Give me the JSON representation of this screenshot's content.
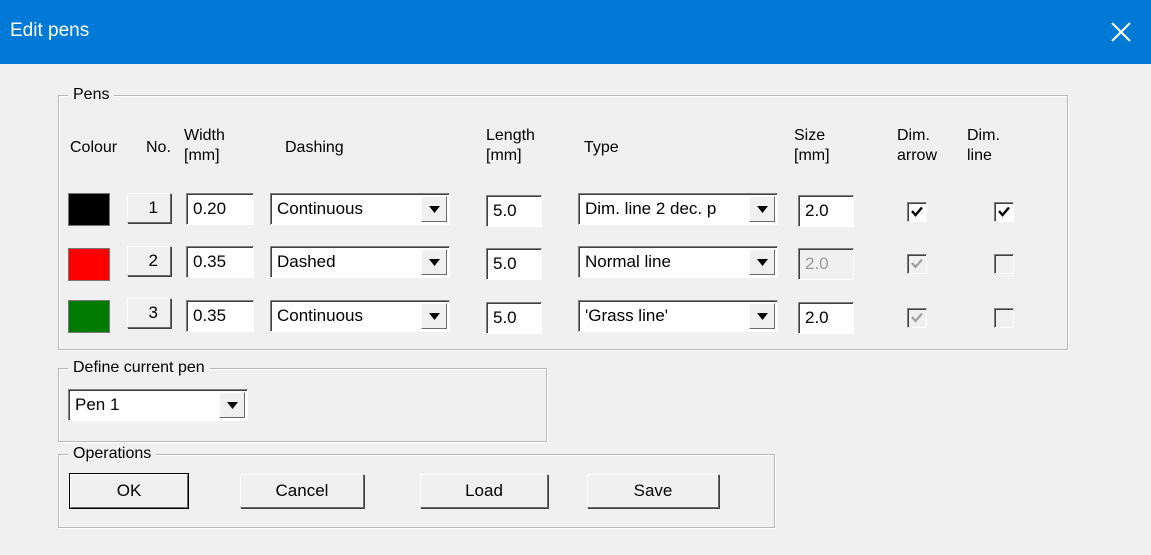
{
  "window": {
    "title": "Edit pens"
  },
  "pens_group": {
    "label": "Pens",
    "headers": {
      "colour": "Colour",
      "no": "No.",
      "width": "Width\n[mm]",
      "dashing": "Dashing",
      "length": "Length\n[mm]",
      "type": "Type",
      "size": "Size\n[mm]",
      "dim_arrow": "Dim.\narrow",
      "dim_line": "Dim.\nline"
    },
    "rows": [
      {
        "colour": "#000000",
        "no": "1",
        "width": "0.20",
        "dashing": "Continuous",
        "length": "5.0",
        "type": "Dim. line 2 dec. p",
        "size": "2.0",
        "size_enabled": true,
        "dim_arrow_checked": true,
        "dim_arrow_enabled": true,
        "dim_line_checked": true,
        "dim_line_enabled": true
      },
      {
        "colour": "#ff0000",
        "no": "2",
        "width": "0.35",
        "dashing": "Dashed",
        "length": "5.0",
        "type": "Normal line",
        "size": "2.0",
        "size_enabled": false,
        "dim_arrow_checked": true,
        "dim_arrow_enabled": false,
        "dim_line_checked": false,
        "dim_line_enabled": false
      },
      {
        "colour": "#007a00",
        "no": "3",
        "width": "0.35",
        "dashing": "Continuous",
        "length": "5.0",
        "type": "'Grass line'",
        "size": "2.0",
        "size_enabled": true,
        "dim_arrow_checked": true,
        "dim_arrow_enabled": false,
        "dim_line_checked": false,
        "dim_line_enabled": false
      }
    ]
  },
  "current_pen_group": {
    "label": "Define current pen",
    "selected": "Pen 1"
  },
  "operations_group": {
    "label": "Operations",
    "buttons": {
      "ok": "OK",
      "cancel": "Cancel",
      "load": "Load",
      "save": "Save"
    }
  }
}
